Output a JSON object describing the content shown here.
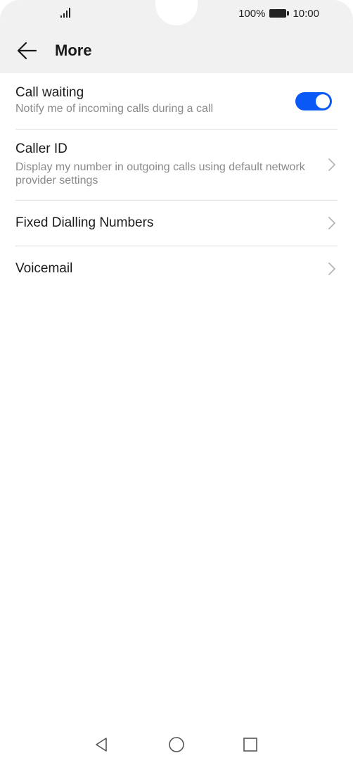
{
  "status_bar": {
    "battery_percent": "100%",
    "time": "10:00",
    "signal_icon": "signal-bars-icon",
    "battery_icon": "battery-full-icon"
  },
  "header": {
    "title": "More",
    "back_icon": "arrow-left-icon"
  },
  "settings": {
    "call_waiting": {
      "title": "Call waiting",
      "subtitle": "Notify me of incoming calls during a call",
      "enabled": true
    },
    "caller_id": {
      "title": "Caller ID",
      "subtitle": "Display my number in outgoing calls using default network provider settings"
    },
    "fixed_dialling": {
      "title": "Fixed Dialling Numbers"
    },
    "voicemail": {
      "title": "Voicemail"
    }
  },
  "nav_bar": {
    "back_icon": "triangle-back-icon",
    "home_icon": "circle-home-icon",
    "recents_icon": "square-recents-icon"
  },
  "colors": {
    "accent": "#0a59f7",
    "header_bg": "#f1f1f1",
    "subtitle": "#8a8a8a",
    "divider": "#dcdcdc"
  }
}
